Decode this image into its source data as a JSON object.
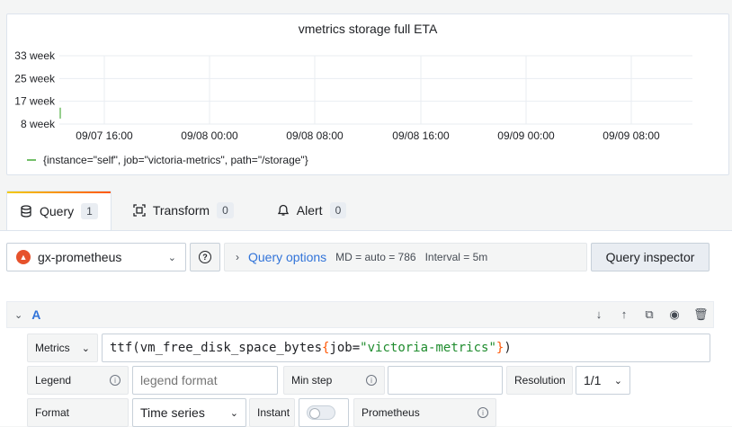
{
  "panel": {
    "title": "vmetrics storage full ETA",
    "legend": "{instance=\"self\", job=\"victoria-metrics\", path=\"/storage\"}"
  },
  "chart_data": {
    "type": "line",
    "title": "vmetrics storage full ETA",
    "y_ticks": [
      "33 week",
      "25 week",
      "17 week",
      "8 week"
    ],
    "x_ticks": [
      "09/07 16:00",
      "09/08 00:00",
      "09/08 08:00",
      "09/08 16:00",
      "09/09 00:00",
      "09/09 08:00"
    ],
    "series": [
      {
        "name": "{instance=\"self\", job=\"victoria-metrics\", path=\"/storage\"}",
        "color": "#73bf69",
        "x": [
          "09/07 12:00",
          "09/07 12:00"
        ],
        "values": [
          10,
          14
        ]
      }
    ],
    "ylim": [
      "8 week",
      "33 week"
    ],
    "grid": true,
    "legend_position": "bottom-left"
  },
  "tabs": [
    {
      "label": "Query",
      "count": "1",
      "icon": "database-icon",
      "active": true
    },
    {
      "label": "Transform",
      "count": "0",
      "icon": "transform-icon",
      "active": false
    },
    {
      "label": "Alert",
      "count": "0",
      "icon": "bell-icon",
      "active": false
    }
  ],
  "datasource": {
    "name": "gx-prometheus"
  },
  "query_options": {
    "label": "Query options",
    "md": "MD = auto = 786",
    "interval": "Interval = 5m"
  },
  "query_inspector": "Query inspector",
  "query": {
    "ref": "A",
    "metrics_label": "Metrics",
    "expr_fn": "ttf(vm_free_disk_space_bytes",
    "expr_open": "{",
    "expr_label": "job=",
    "expr_value": "\"victoria-metrics\"",
    "expr_close": "}",
    "expr_end": ")",
    "legend_label": "Legend",
    "legend_placeholder": "legend format",
    "min_step_label": "Min step",
    "min_step_value": "",
    "resolution_label": "Resolution",
    "resolution_value": "1/1",
    "format_label": "Format",
    "format_value": "Time series",
    "instant_label": "Instant",
    "prometheus_label": "Prometheus"
  }
}
